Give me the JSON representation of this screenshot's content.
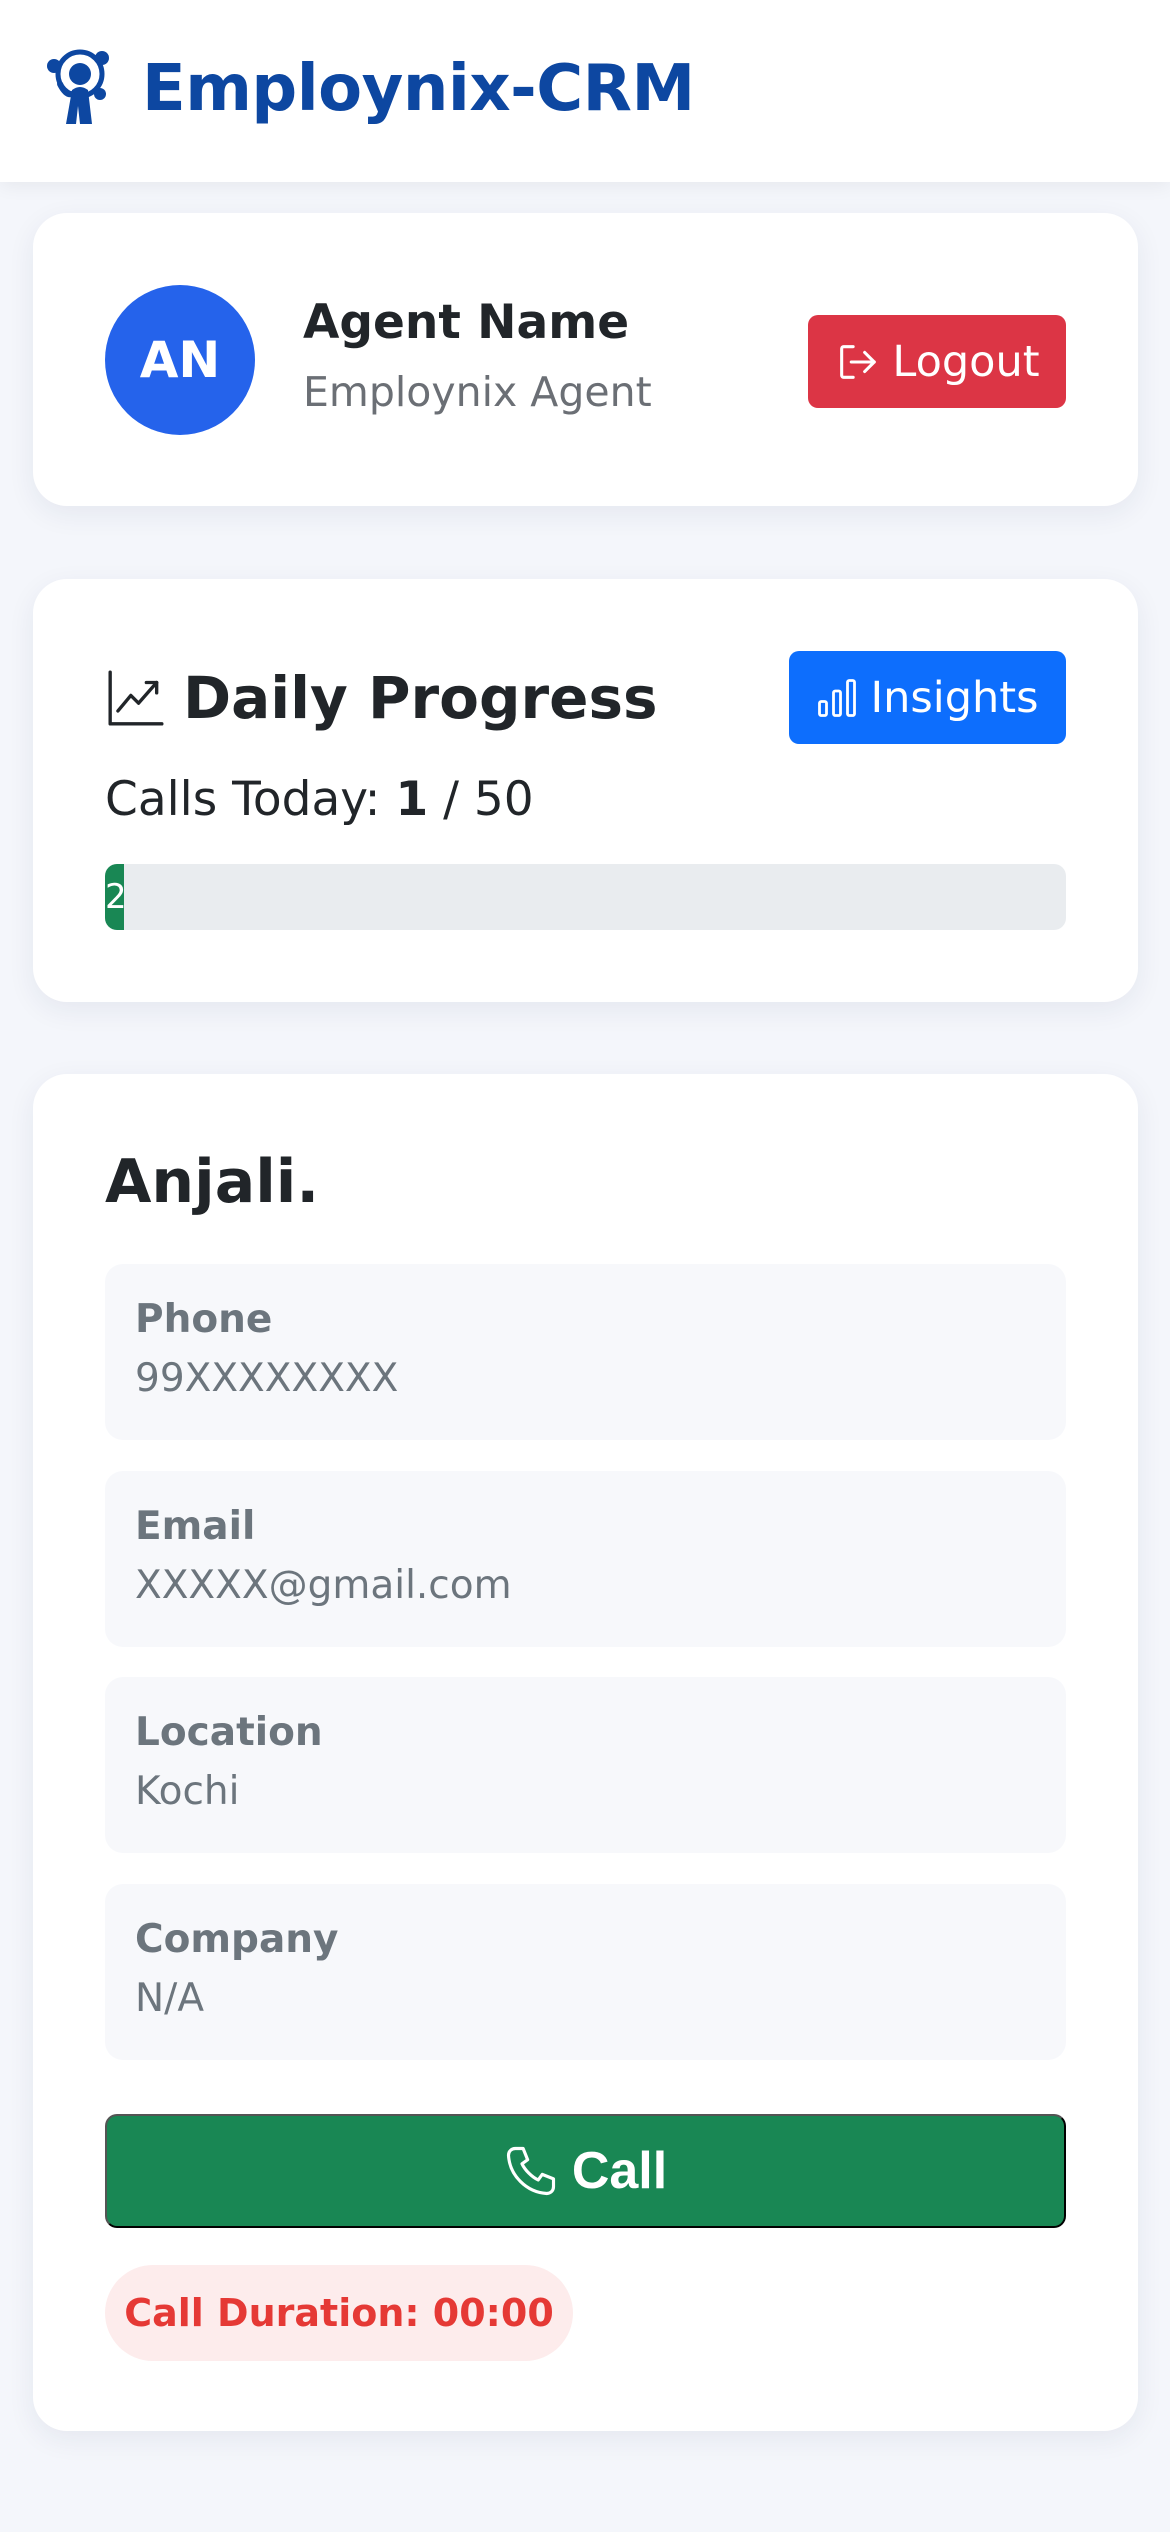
{
  "header": {
    "brand_name": "Employnix-CRM",
    "logo_icon": "person-network-logo",
    "brand_color": "#0d47a1"
  },
  "agent": {
    "initials": "AN",
    "name": "Agent Name",
    "role": "Employnix Agent",
    "logout_label": "Logout",
    "avatar_color": "#2563eb",
    "logout_color": "#dc3545"
  },
  "progress": {
    "title": "Daily Progress",
    "title_icon": "line-chart-icon",
    "insights_label": "Insights",
    "insights_icon": "bar-chart-icon",
    "calls_label": "Calls Today:",
    "calls_done": "1",
    "calls_separator": "/ 50",
    "bar_text": "2",
    "bar_fraction": 0.02,
    "bar_color": "#198754"
  },
  "lead": {
    "name": "Anjali.",
    "fields": [
      {
        "label": "Phone",
        "value": "99XXXXXXXX"
      },
      {
        "label": "Email",
        "value": "XXXXX@gmail.com"
      },
      {
        "label": "Location",
        "value": "Kochi"
      },
      {
        "label": "Company",
        "value": "N/A"
      }
    ],
    "call_label": "Call",
    "call_icon": "phone-icon",
    "call_color": "#198754",
    "duration_text": "Call Duration: 00:00"
  }
}
